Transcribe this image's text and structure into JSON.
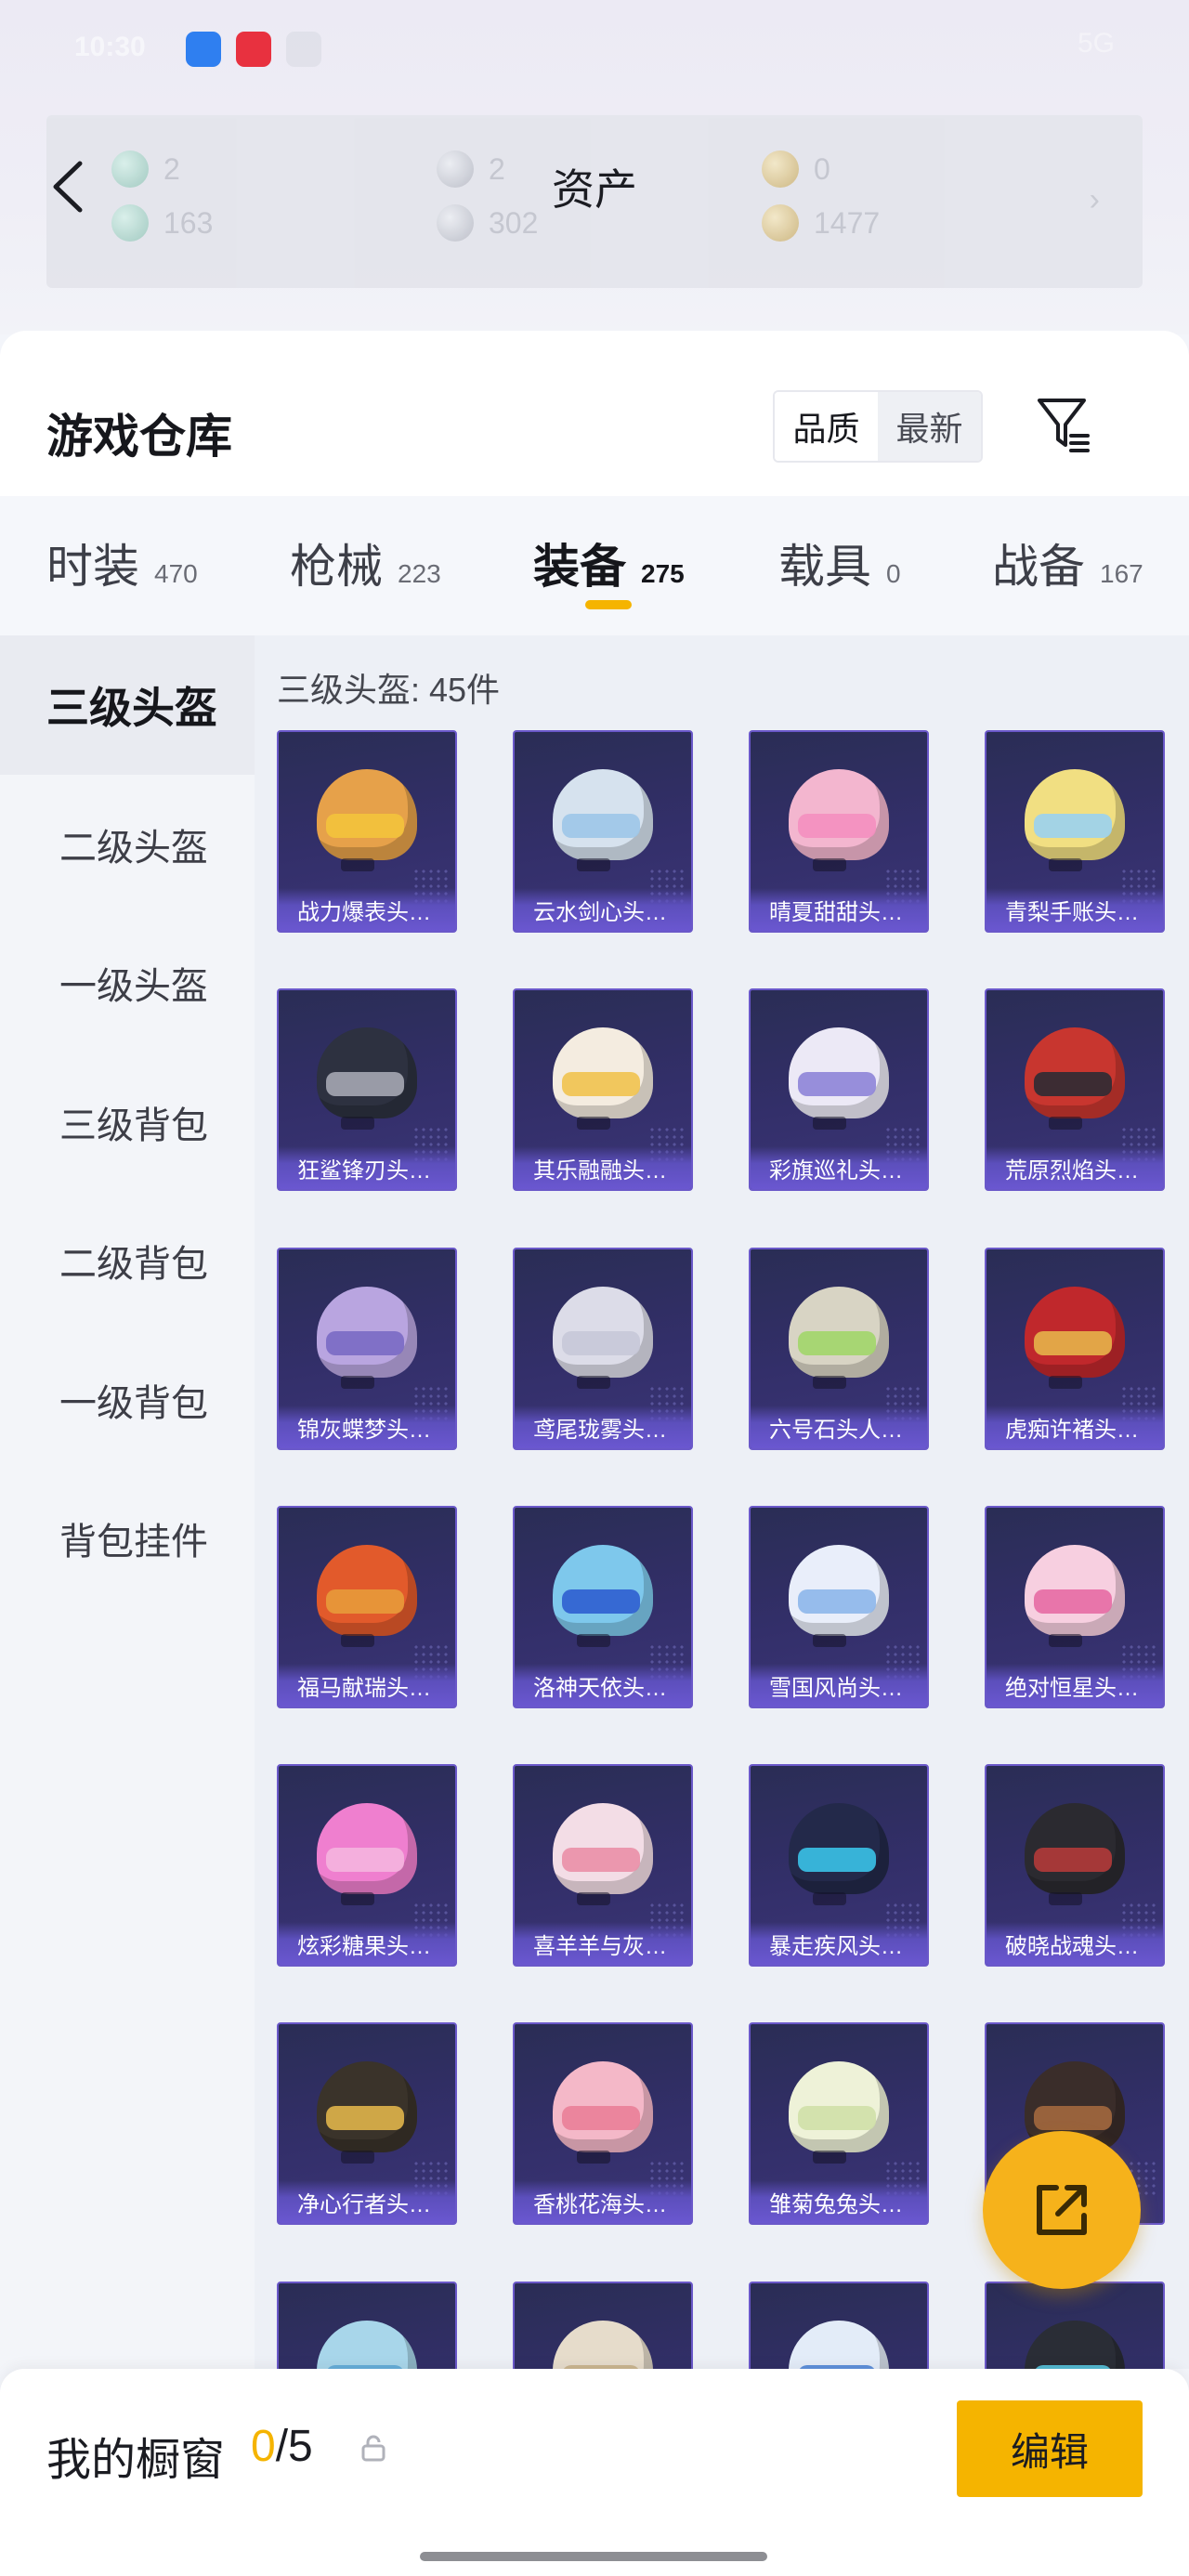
{
  "status_bar": {
    "time": "10:30",
    "right": "5G"
  },
  "header": {
    "title": "资产",
    "back_label": "back"
  },
  "assets": [
    {
      "value": "2",
      "coin": "teal"
    },
    {
      "value": "2",
      "coin": "silver"
    },
    {
      "value": "0",
      "coin": "gold"
    },
    {
      "value": "163",
      "coin": "teal"
    },
    {
      "value": "302",
      "coin": "silver"
    },
    {
      "value": "1477",
      "coin": "gold"
    }
  ],
  "asset_arrow": "›",
  "warehouse": {
    "title": "游戏仓库",
    "sort_options": [
      "品质",
      "最新"
    ],
    "sort_selected": "品质"
  },
  "tabs": [
    {
      "label": "时装",
      "count": "470"
    },
    {
      "label": "枪械",
      "count": "223"
    },
    {
      "label": "装备",
      "count": "275",
      "active": true
    },
    {
      "label": "载具",
      "count": "0"
    },
    {
      "label": "战备",
      "count": "167"
    }
  ],
  "sidebar": [
    {
      "label": "三级头盔",
      "active": true
    },
    {
      "label": "二级头盔"
    },
    {
      "label": "一级头盔"
    },
    {
      "label": "三级背包"
    },
    {
      "label": "二级背包"
    },
    {
      "label": "一级背包"
    },
    {
      "label": "背包挂件"
    }
  ],
  "grid": {
    "header": "三级头盔: 45件",
    "items": [
      {
        "name": "战力爆表头…",
        "helmet": "#e6a14a",
        "visor": "#f3c33c"
      },
      {
        "name": "云水剑心头…",
        "helmet": "#d6e2ee",
        "visor": "#9dc6e8"
      },
      {
        "name": "晴夏甜甜头…",
        "helmet": "#f3b6cf",
        "visor": "#f48fbf"
      },
      {
        "name": "青梨手账头…",
        "helmet": "#f1df82",
        "visor": "#9ad2f0"
      },
      {
        "name": "狂鲨锋刃头…",
        "helmet": "#2d3140",
        "visor": "#a5a7b3"
      },
      {
        "name": "其乐融融头…",
        "helmet": "#f4ece0",
        "visor": "#f1c34f"
      },
      {
        "name": "彩旗巡礼头…",
        "helmet": "#ece9f6",
        "visor": "#8e84d8"
      },
      {
        "name": "荒原烈焰头…",
        "helmet": "#c8362f",
        "visor": "#2c2b34"
      },
      {
        "name": "锦灰蝶梦头…",
        "helmet": "#b9a5e0",
        "visor": "#7a6ac4"
      },
      {
        "name": "鸢尾珑雾头…",
        "helmet": "#dcdce8",
        "visor": "#c7c8d8"
      },
      {
        "name": "六号石头人…",
        "helmet": "#d8d4c4",
        "visor": "#a2d66a"
      },
      {
        "name": "虎痴许褚头…",
        "helmet": "#c0282c",
        "visor": "#e6b24a"
      },
      {
        "name": "福马献瑞头…",
        "helmet": "#e25a2b",
        "visor": "#e89a3a"
      },
      {
        "name": "洛神天依头…",
        "helmet": "#7ec8ec",
        "visor": "#2f5ed0"
      },
      {
        "name": "雪国风尚头…",
        "helmet": "#e9eefa",
        "visor": "#8db6ea"
      },
      {
        "name": "绝对恒星头…",
        "helmet": "#f7cfe0",
        "visor": "#e66aa4"
      },
      {
        "name": "炫彩糖果头…",
        "helmet": "#ef7fcf",
        "visor": "#f4b5de"
      },
      {
        "name": "喜羊羊与灰…",
        "helmet": "#f3dde6",
        "visor": "#ea8fa7"
      },
      {
        "name": "暴走疾风头…",
        "helmet": "#23294a",
        "visor": "#3ac2e8"
      },
      {
        "name": "破晓战魂头…",
        "helmet": "#2b2a30",
        "visor": "#b23a3a"
      },
      {
        "name": "净心行者头…",
        "helmet": "#3a332a",
        "visor": "#e0b44a"
      },
      {
        "name": "香桃花海头…",
        "helmet": "#f4b8c8",
        "visor": "#ea7f98"
      },
      {
        "name": "雏菊兔兔头…",
        "helmet": "#eef2d8",
        "visor": "#cfe0a8"
      },
      {
        "name": "",
        "helmet": "#3a2d2a",
        "visor": "#a3683e"
      },
      {
        "name": "",
        "helmet": "#a8d6ea",
        "visor": "#5ea8d6"
      },
      {
        "name": "",
        "helmet": "#e6dccb",
        "visor": "#c7b08a"
      },
      {
        "name": "",
        "helmet": "#e3ecf8",
        "visor": "#4f86d6"
      },
      {
        "name": "",
        "helmet": "#2a2d36",
        "visor": "#58c6e0"
      }
    ]
  },
  "showcase": {
    "label": "我的橱窗",
    "used": "0",
    "separator": "/",
    "total": "5"
  },
  "edit_label": "编辑",
  "colors": {
    "accent": "#f5b400",
    "card_border": "#6a58c9",
    "fab": "#f6b21b"
  }
}
